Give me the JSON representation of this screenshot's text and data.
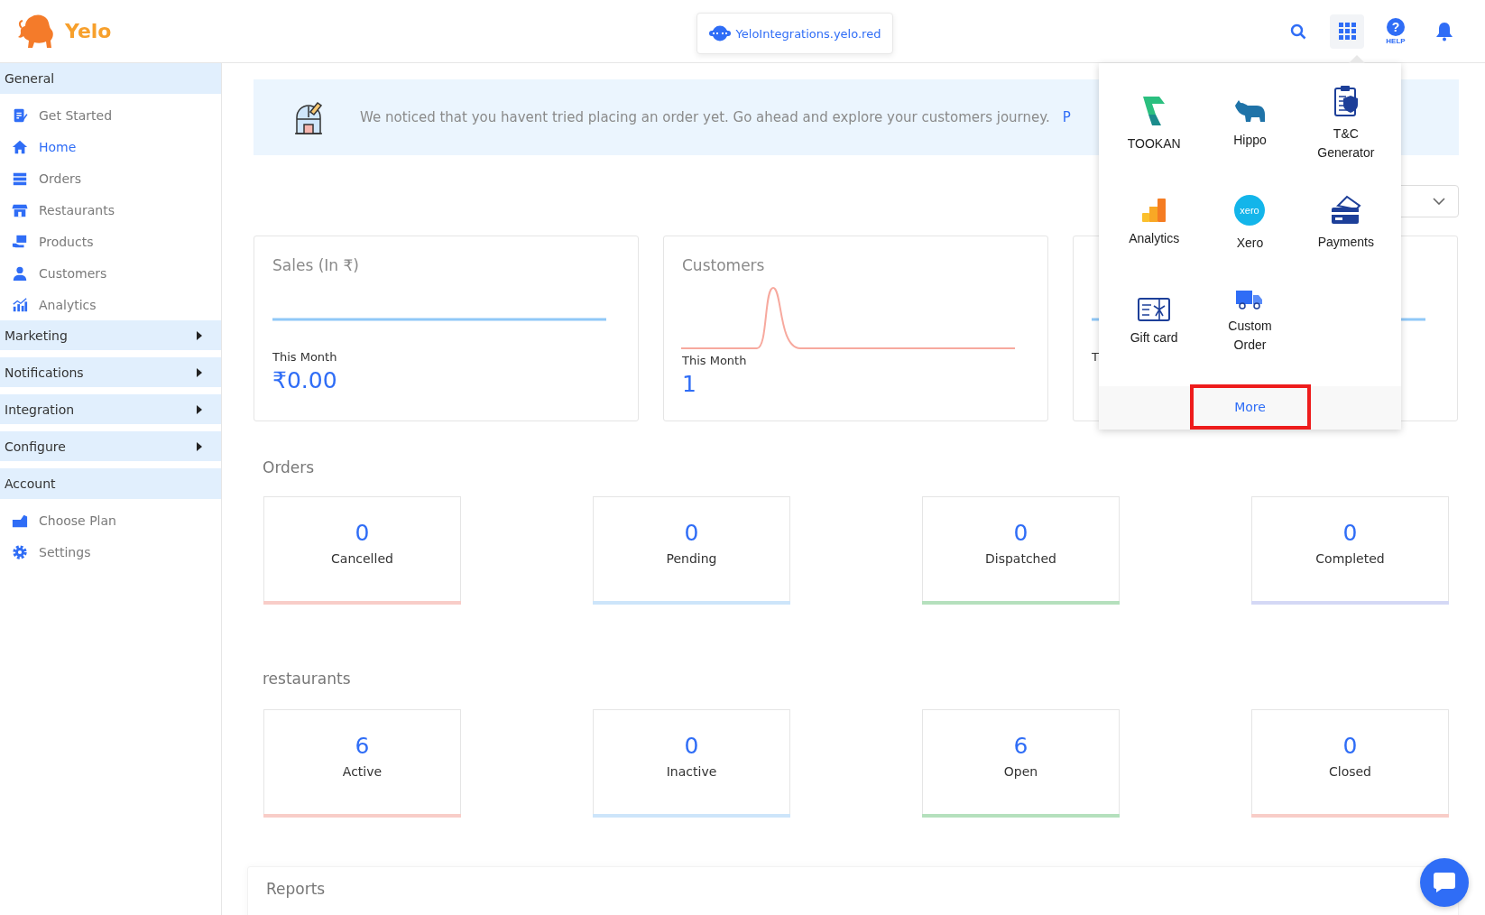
{
  "header": {
    "brand": "Yelo",
    "domain": "YeloIntegrations.yelo.red",
    "help_mark": "?",
    "help_label": "HELP",
    "apps_menu_open": true
  },
  "sidebar": {
    "sections": [
      {
        "label": "General",
        "kind": "header",
        "items": [
          {
            "label": "Get Started",
            "kind": "document",
            "selected": false
          },
          {
            "label": "Home",
            "kind": "home",
            "selected": true
          },
          {
            "label": "Orders",
            "kind": "list",
            "selected": false
          },
          {
            "label": "Restaurants",
            "kind": "store",
            "selected": false
          },
          {
            "label": "Products",
            "kind": "box",
            "selected": false
          },
          {
            "label": "Customers",
            "kind": "person",
            "selected": false
          },
          {
            "label": "Analytics",
            "kind": "chart",
            "selected": false
          }
        ]
      },
      {
        "label": "Marketing",
        "kind": "collapsible",
        "expanded": false
      },
      {
        "label": "Notifications",
        "kind": "collapsible",
        "expanded": false
      },
      {
        "label": "Integration",
        "kind": "collapsible",
        "expanded": false
      },
      {
        "label": "Configure",
        "kind": "collapsible",
        "expanded": false
      },
      {
        "label": "Account",
        "kind": "header",
        "items": [
          {
            "label": "Choose Plan",
            "kind": "plan",
            "selected": false
          },
          {
            "label": "Settings",
            "kind": "gear",
            "selected": false
          }
        ]
      }
    ]
  },
  "banner": {
    "text": "We noticed that you havent tried placing an order yet. Go ahead and explore your customers journey.",
    "link": "P"
  },
  "stats": [
    {
      "title": "Sales (In ₹)",
      "label": "This Month",
      "value": "₹0.00",
      "kind": "flat"
    },
    {
      "title": "Customers",
      "label": "This Month",
      "value": "1",
      "kind": "peak"
    },
    {
      "label": "T",
      "kind": "flat"
    }
  ],
  "orders": {
    "title": "Orders",
    "cards": [
      {
        "count": "0",
        "label": "Cancelled",
        "color": "#f8cdc8"
      },
      {
        "count": "0",
        "label": "Pending",
        "color": "#cde5fa"
      },
      {
        "count": "0",
        "label": "Dispatched",
        "color": "#b5e0bd"
      },
      {
        "count": "0",
        "label": "Completed",
        "color": "#d4d8f5"
      }
    ]
  },
  "restaurants": {
    "title": "restaurants",
    "cards": [
      {
        "count": "6",
        "label": "Active",
        "color": "#f8cdc8"
      },
      {
        "count": "0",
        "label": "Inactive",
        "color": "#cde5fa"
      },
      {
        "count": "6",
        "label": "Open",
        "color": "#b5e0bd"
      },
      {
        "count": "0",
        "label": "Closed",
        "color": "#f8cdc8"
      }
    ]
  },
  "reports": {
    "title": "Reports"
  },
  "apps_menu": {
    "apps": [
      {
        "label": "TOOKAN",
        "kind": "tookan"
      },
      {
        "label": "Hippo",
        "kind": "hippo"
      },
      {
        "label": "T&C Generator",
        "kind": "clipboard"
      },
      {
        "label": "Analytics",
        "kind": "bars"
      },
      {
        "label": "Xero",
        "kind": "xero",
        "icon_text": "xero"
      },
      {
        "label": "Payments",
        "kind": "card"
      },
      {
        "label": "Gift card",
        "kind": "gift"
      },
      {
        "label": "Custom Order",
        "kind": "truck"
      }
    ],
    "more": {
      "label": "More",
      "highlighted": true
    }
  }
}
